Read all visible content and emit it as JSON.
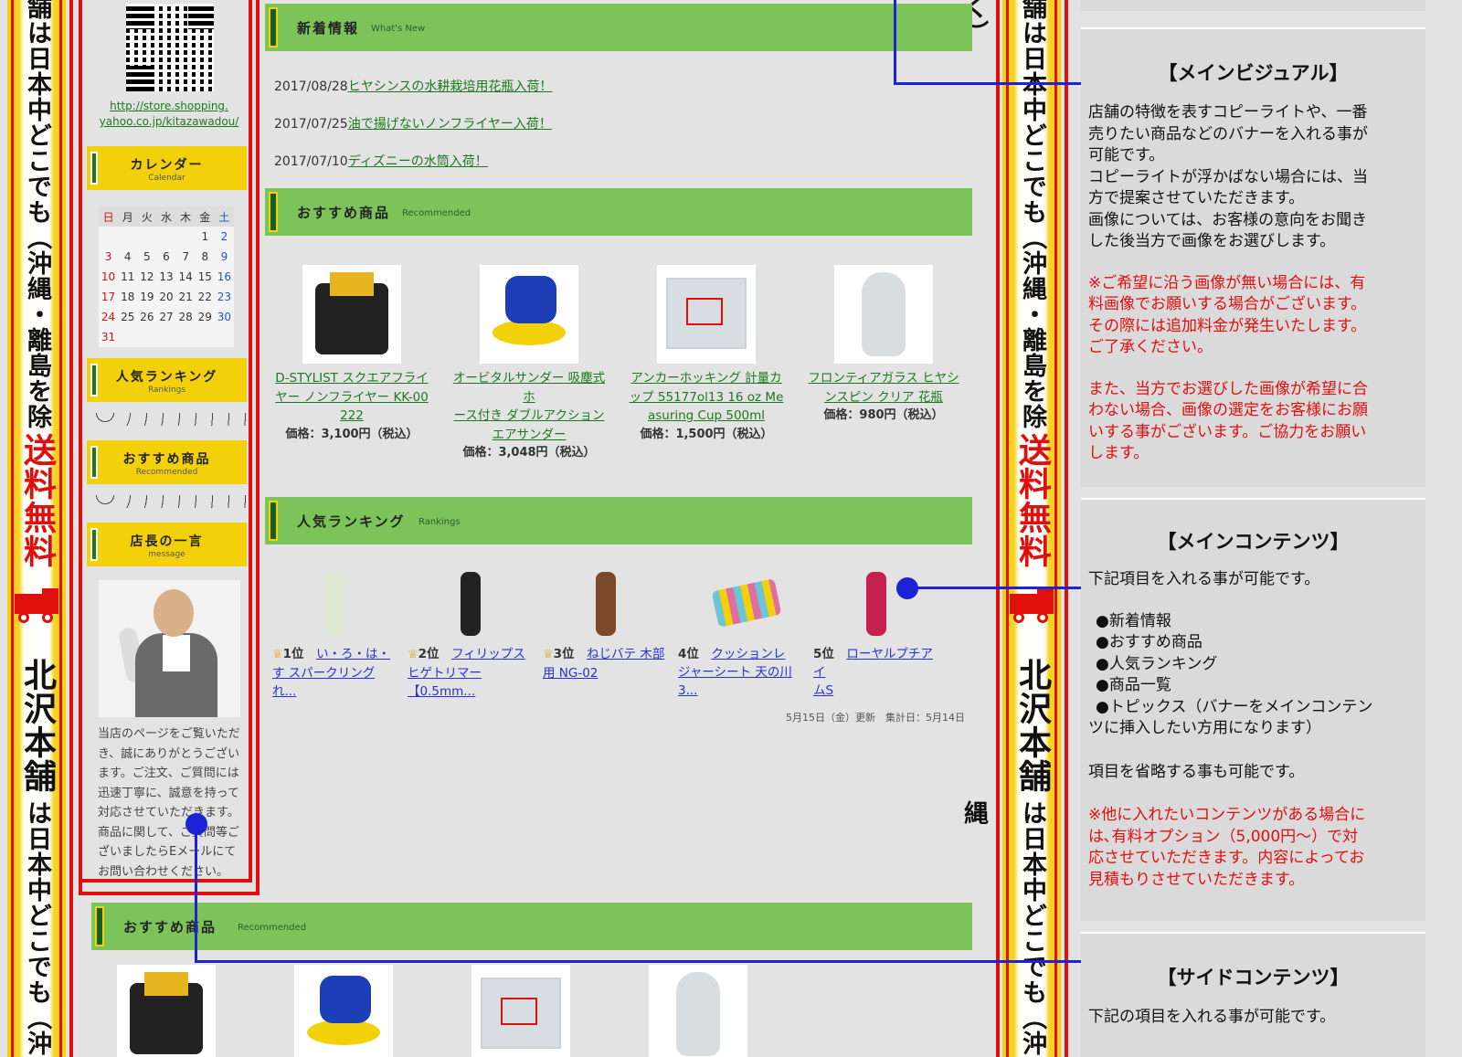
{
  "left_banner": {
    "top_text": "舗は日本中どこでも（沖縄・離島を除く）",
    "free_shipping": "送料無料",
    "shop_name": "北沢本舗",
    "bottom_text": "は日本中どこでも（沖縄"
  },
  "right_banner": {
    "top_text": "舗は日本中どこでも（沖縄・離島を除く）",
    "free_shipping": "送料無料",
    "shop_name": "北沢本舗",
    "bottom_text": "は日本中どこでも（沖縄"
  },
  "sidebar": {
    "url_line1": "http://store.shopping.",
    "url_line2": "yahoo.co.jp/kitazawadou/",
    "calendar": {
      "title": "カレンダー",
      "subtitle": "Calendar",
      "weekdays": [
        "日",
        "月",
        "火",
        "水",
        "木",
        "金",
        "土"
      ],
      "weeks": [
        [
          "",
          "",
          "",
          "",
          "",
          "1",
          "2"
        ],
        [
          "3",
          "4",
          "5",
          "6",
          "7",
          "8",
          "9"
        ],
        [
          "10",
          "11",
          "12",
          "13",
          "14",
          "15",
          "16"
        ],
        [
          "17",
          "18",
          "19",
          "20",
          "21",
          "22",
          "23"
        ],
        [
          "24",
          "25",
          "26",
          "27",
          "28",
          "29",
          "30"
        ],
        [
          "31",
          "",
          "",
          "",
          "",
          "",
          ""
        ]
      ]
    },
    "ranking": {
      "title": "人気ランキング",
      "subtitle": "Rankings"
    },
    "recommended": {
      "title": "おすすめ商品",
      "subtitle": "Recommended"
    },
    "message": {
      "title": "店長の一言",
      "subtitle": "message",
      "lines": [
        "当店のページをご覧いただ",
        "き、誠にありがとうござい",
        "ます。ご注文、ご質問には",
        "迅速丁寧に、誠意を持って",
        "対応させていただきます。",
        "商品に関して、ご質問等ご",
        "ざいましたらEメールにて",
        "お問い合わせください。"
      ]
    }
  },
  "main": {
    "news": {
      "title": "新着情報",
      "subtitle": "What's New",
      "items": [
        {
          "date": "2017/08/28",
          "text": "ヒヤシンスの水耕栽培用花瓶入荷！"
        },
        {
          "date": "2017/07/25",
          "text": "油で揚げないノンフライヤー入荷！"
        },
        {
          "date": "2017/07/10",
          "text": "ディズニーの水筒入荷！"
        }
      ]
    },
    "recommended": {
      "title": "おすすめ商品",
      "subtitle": "Recommended",
      "products": [
        {
          "name_lines": [
            "D-STYLIST スクエアフライ",
            "ヤー ノンフライヤー KK-00",
            "222"
          ],
          "price": "価格：3,100円（税込）"
        },
        {
          "name_lines": [
            "オービタルサンダー 吸塵式ホ",
            "ース付き ダブルアクション",
            "エアサンダー"
          ],
          "price": "価格：3,048円（税込）"
        },
        {
          "name_lines": [
            "アンカーホッキング 計量カ",
            "ップ 55177ol13 16 oz Me",
            "asuring Cup 500ml"
          ],
          "price": "価格：1,500円（税込）"
        },
        {
          "name_lines": [
            "フロンティアガラス ヒヤシ",
            "ンスピン クリア 花瓶"
          ],
          "price": "価格：980円（税込）"
        }
      ]
    },
    "ranking": {
      "title": "人気ランキング",
      "subtitle": "Rankings",
      "items": [
        {
          "pos": "1位",
          "name_l1": "い・ろ・は・",
          "name_l2": "す スパークリング れ..."
        },
        {
          "pos": "2位",
          "name_l1": "フィリップス",
          "name_l2": "ヒゲトリマー",
          "name_l3": "【0.5mm..."
        },
        {
          "pos": "3位",
          "name_l1": "ねじバテ 木部",
          "name_l2": "用 NG-02"
        },
        {
          "pos": "4位",
          "name_l1": "クッションレ",
          "name_l2": "ジャーシート 天の川",
          "name_l3": "3..."
        },
        {
          "pos": "5位",
          "name_l1": "ローヤルプチアイ",
          "name_l2": "ムS"
        }
      ],
      "updated": "5月15日（金）更新　集計日：5月14日"
    },
    "recommended2": {
      "title": "おすすめ商品",
      "subtitle": "Recommended"
    }
  },
  "explain": {
    "visual": {
      "title": "【メインビジュアル】",
      "lines": [
        "店舗の特徴を表すコピーライトや、一番",
        "売りたい商品などのバナーを入れる事が",
        "可能です。",
        "コピーライトが浮かばない場合には、当",
        "方で提案させていただきます。",
        "画像については、お客様の意向をお聞き",
        "した後当方で画像をお選びします。"
      ],
      "red_lines": [
        "※ご希望に沿う画像が無い場合には、有",
        "料画像でお願いする場合がございます。",
        "その際には追加料金が発生いたします。",
        "ご了承ください。"
      ],
      "red_lines2": [
        "また、当方でお選びした画像が希望に合",
        "わない場合、画像の選定をお客様にお願",
        "いする事がございます。ご協力をお願い",
        "します。"
      ]
    },
    "contents": {
      "title": "【メインコンテンツ】",
      "intro": "下記項目を入れる事が可能です。",
      "bullets": [
        "●新着情報",
        "●おすすめ商品",
        "●人気ランキング",
        "●商品一覧",
        "●トピックス（バナーをメインコンテン"
      ],
      "bullet_cont": "ツに挿入したい方用になります）",
      "omit": "項目を省略する事も可能です。",
      "red_lines": [
        "※他に入れたいコンテンツがある場合に",
        "は､有料オプション（5,000円〜）で対",
        "応させていただきます。内容によってお",
        "見積もりさせていただきます。"
      ]
    },
    "side": {
      "title": "【サイドコンテンツ】",
      "intro": "下記の項目を入れる事が可能です。"
    }
  },
  "colors": {
    "accent_red": "#e10e0e",
    "header_green": "#7cc45a",
    "sidebar_yellow": "#f2d10b",
    "annotation_blue": "#1c22d8"
  }
}
